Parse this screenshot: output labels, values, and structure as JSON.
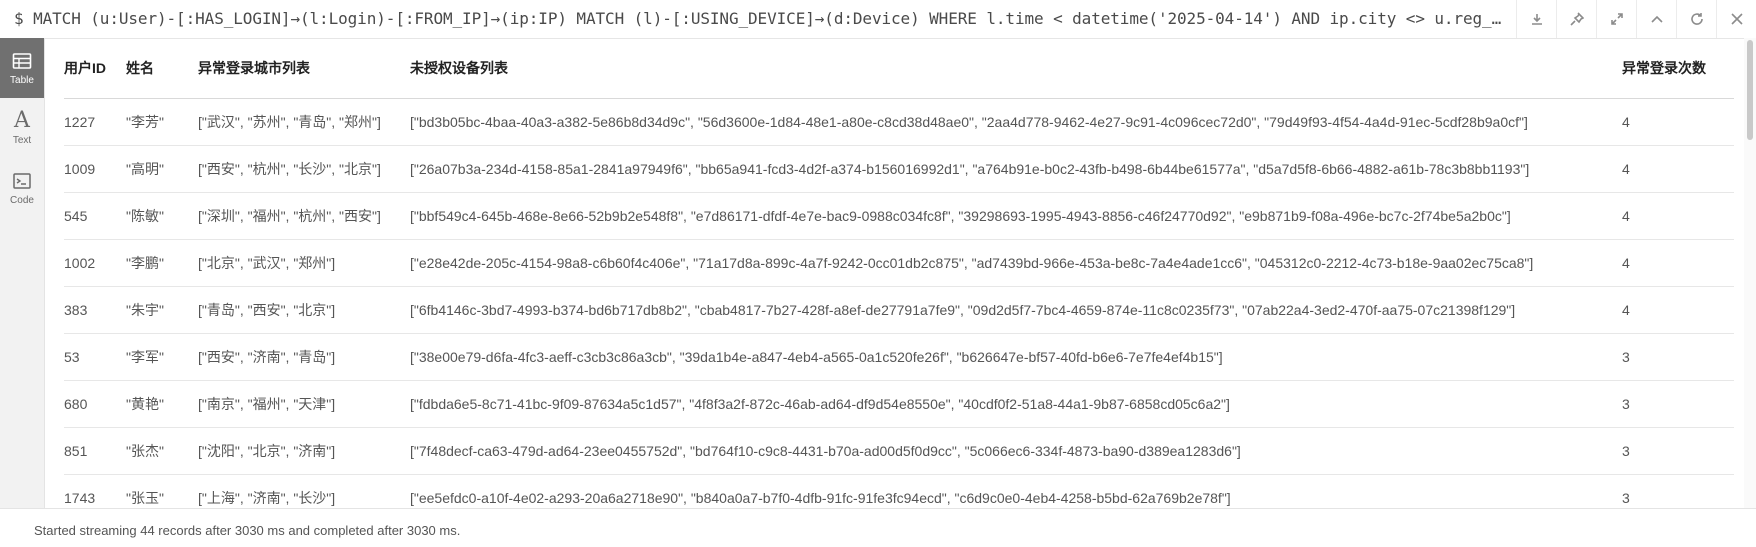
{
  "query": {
    "text": "$ MATCH (u:User)-[:HAS_LOGIN]→(l:Login)-[:FROM_IP]→(ip:IP) MATCH (l)-[:USING_DEVICE]→(d:Device) WHERE l.time < datetime('2025-04-14') AND ip.city <> u.reg_…"
  },
  "toolbar": {
    "icons": [
      "download-icon",
      "pin-icon",
      "expand-icon",
      "collapse-up-icon",
      "refresh-icon",
      "close-icon"
    ]
  },
  "sidebar": {
    "items": [
      {
        "label": "Table",
        "icon": "table-icon",
        "active": true
      },
      {
        "label": "Text",
        "icon": "text-icon",
        "active": false
      },
      {
        "label": "Code",
        "icon": "code-icon",
        "active": false
      }
    ]
  },
  "table": {
    "headers": [
      "用户ID",
      "姓名",
      "异常登录城市列表",
      "未授权设备列表",
      "异常登录次数"
    ],
    "rows": [
      [
        "1227",
        "\"李芳\"",
        "[\"武汉\", \"苏州\", \"青岛\", \"郑州\"]",
        "[\"bd3b05bc-4baa-40a3-a382-5e86b8d34d9c\", \"56d3600e-1d84-48e1-a80e-c8cd38d48ae0\", \"2aa4d778-9462-4e27-9c91-4c096cec72d0\", \"79d49f93-4f54-4a4d-91ec-5cdf28b9a0cf\"]",
        "4"
      ],
      [
        "1009",
        "\"高明\"",
        "[\"西安\", \"杭州\", \"长沙\", \"北京\"]",
        "[\"26a07b3a-234d-4158-85a1-2841a97949f6\", \"bb65a941-fcd3-4d2f-a374-b156016992d1\", \"a764b91e-b0c2-43fb-b498-6b44be61577a\", \"d5a7d5f8-6b66-4882-a61b-78c3b8bb1193\"]",
        "4"
      ],
      [
        "545",
        "\"陈敏\"",
        "[\"深圳\", \"福州\", \"杭州\", \"西安\"]",
        "[\"bbf549c4-645b-468e-8e66-52b9b2e548f8\", \"e7d86171-dfdf-4e7e-bac9-0988c034fc8f\", \"39298693-1995-4943-8856-c46f24770d92\", \"e9b871b9-f08a-496e-bc7c-2f74be5a2b0c\"]",
        "4"
      ],
      [
        "1002",
        "\"李鹏\"",
        "[\"北京\", \"武汉\", \"郑州\"]",
        "[\"e28e42de-205c-4154-98a8-c6b60f4c406e\", \"71a17d8a-899c-4a7f-9242-0cc01db2c875\", \"ad7439bd-966e-453a-be8c-7a4e4ade1cc6\", \"045312c0-2212-4c73-b18e-9aa02ec75ca8\"]",
        "4"
      ],
      [
        "383",
        "\"朱宇\"",
        "[\"青岛\", \"西安\", \"北京\"]",
        "[\"6fb4146c-3bd7-4993-b374-bd6b717db8b2\", \"cbab4817-7b27-428f-a8ef-de27791a7fe9\", \"09d2d5f7-7bc4-4659-874e-11c8c0235f73\", \"07ab22a4-3ed2-470f-aa75-07c21398f129\"]",
        "4"
      ],
      [
        "53",
        "\"李军\"",
        "[\"西安\", \"济南\", \"青岛\"]",
        "[\"38e00e79-d6fa-4fc3-aeff-c3cb3c86a3cb\", \"39da1b4e-a847-4eb4-a565-0a1c520fe26f\", \"b626647e-bf57-40fd-b6e6-7e7fe4ef4b15\"]",
        "3"
      ],
      [
        "680",
        "\"黄艳\"",
        "[\"南京\", \"福州\", \"天津\"]",
        "[\"fdbda6e5-8c71-41bc-9f09-87634a5c1d57\", \"4f8f3a2f-872c-46ab-ad64-df9d54e8550e\", \"40cdf0f2-51a8-44a1-9b87-6858cd05c6a2\"]",
        "3"
      ],
      [
        "851",
        "\"张杰\"",
        "[\"沈阳\", \"北京\", \"济南\"]",
        "[\"7f48decf-ca63-479d-ad64-23ee0455752d\", \"bd764f10-c9c8-4431-b70a-ad00d5f0d9cc\", \"5c066ec6-334f-4873-ba90-d389ea1283d6\"]",
        "3"
      ],
      [
        "1743",
        "\"张玉\"",
        "[\"上海\", \"济南\", \"长沙\"]",
        "[\"ee5efdc0-a10f-4e02-a293-20a6a2718e90\", \"b840a0a7-b7f0-4dfb-91fc-91fe3fc94ecd\", \"c6d9c0e0-4eb4-4258-b5bd-62a769b2e78f\"]",
        "3"
      ]
    ]
  },
  "status": {
    "text": "Started streaming 44 records after 3030 ms and completed after 3030 ms."
  }
}
